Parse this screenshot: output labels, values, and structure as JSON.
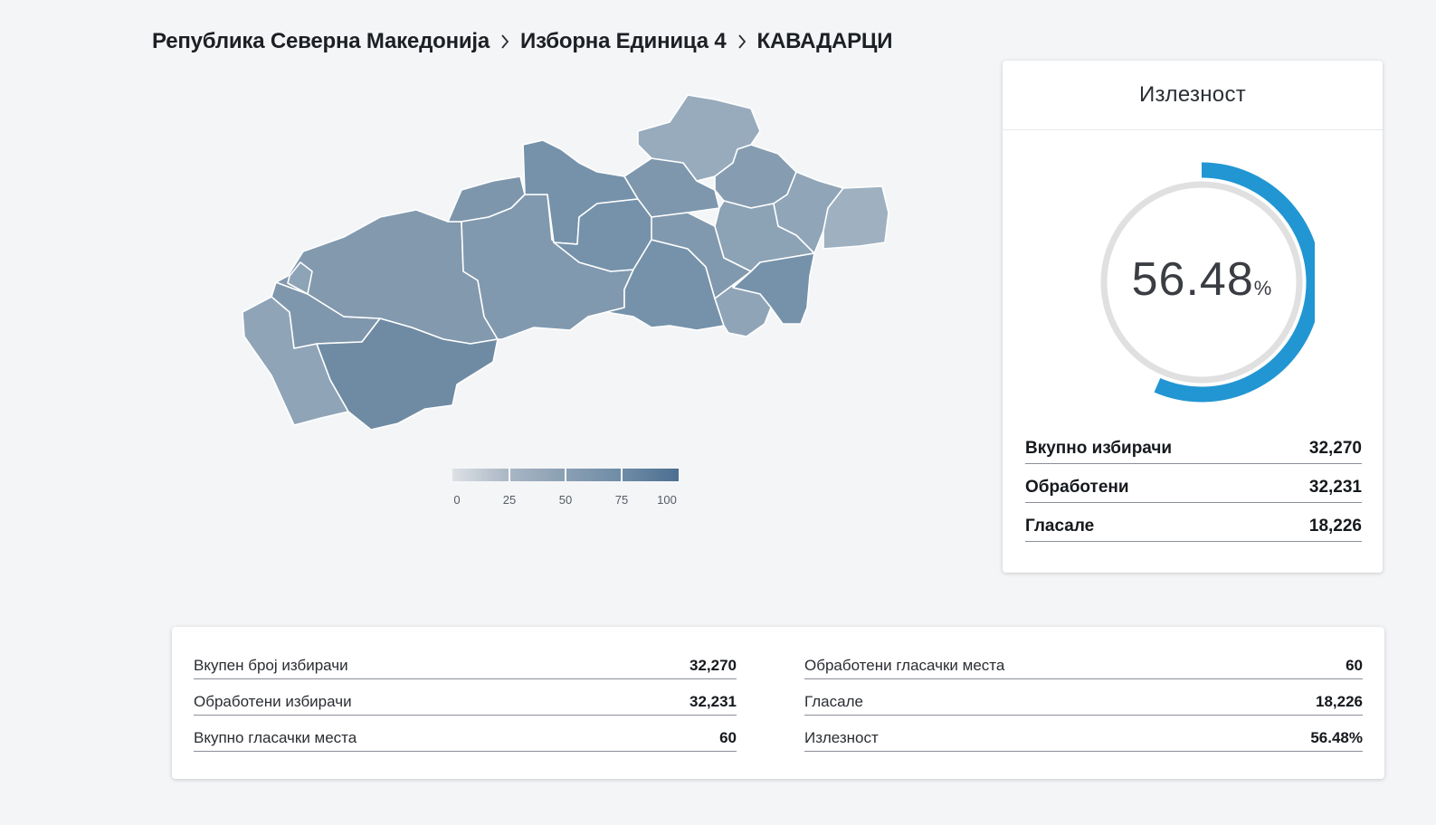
{
  "breadcrumb": {
    "items": [
      "Република Северна Македонија",
      "Изборна Единица 4",
      "КАВАДАРЦИ"
    ]
  },
  "legend": {
    "labels": [
      "0",
      "25",
      "50",
      "75",
      "100"
    ]
  },
  "turnout_card": {
    "title": "Излезност",
    "percent": "56.48",
    "percent_sign": "%",
    "fill_fraction": 0.5648,
    "accent_color": "#2196d3",
    "track_color": "#e0e0e0",
    "rows": [
      {
        "label": "Вкупно избирачи",
        "value": "32,270"
      },
      {
        "label": "Обработени",
        "value": "32,231"
      },
      {
        "label": "Гласале",
        "value": "18,226"
      }
    ]
  },
  "summary": {
    "left": [
      {
        "label": "Вкупен број избирачи",
        "value": "32,270"
      },
      {
        "label": "Обработени избирачи",
        "value": "32,231"
      },
      {
        "label": "Вкупно гласачки места",
        "value": "60"
      }
    ],
    "right": [
      {
        "label": "Обработени гласачки места",
        "value": "60"
      },
      {
        "label": "Гласале",
        "value": "18,226"
      },
      {
        "label": "Излезност",
        "value": "56.48%"
      }
    ]
  }
}
